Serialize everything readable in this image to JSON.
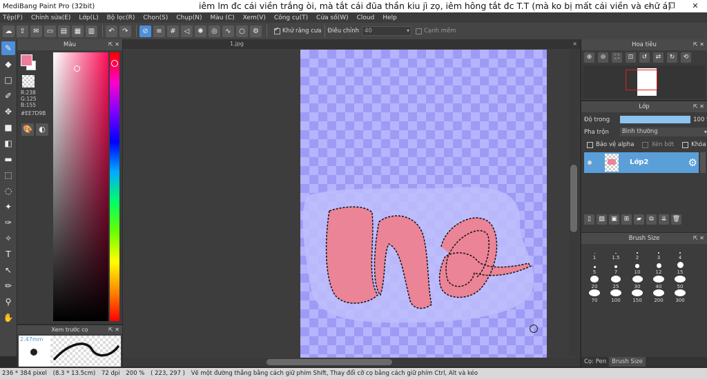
{
  "window": {
    "title": "MediBang Paint Pro (32bit)",
    "overlay_caption": "iêm lm đc cái viền trắng òi, mà tắt cái đũa thần kiu jì zọ, iêm hông tắt đc T.T (mà ko bị mất cái viền và chữ á)",
    "controls": [
      "—",
      "❐",
      "✕"
    ]
  },
  "menu": [
    "Tệp(F)",
    "Chỉnh sửa(E)",
    "Lớp(L)",
    "Bộ lọc(R)",
    "Chọn(S)",
    "Chụp(N)",
    "Màu (C)",
    "Xem(V)",
    "Công cụ(T)",
    "Cửa số(W)",
    "Cloud",
    "Help"
  ],
  "toolbar": {
    "antialias_label": "Khử răng cưa",
    "antialias_checked": true,
    "correction_label": "Điều chỉnh",
    "correction_value": "40",
    "edge_label": "Cạnh mềm",
    "edge_checked": false
  },
  "color_panel": {
    "title": "Màu",
    "foreground": "#EE7D9B",
    "background": "#FFFFFF",
    "r_label": "R:238",
    "g_label": "G:125",
    "b_label": "B:155",
    "hex_label": "#EE7D9B"
  },
  "brush_preview": {
    "title": "Xem trước cọ",
    "size_label": "2.47mm"
  },
  "document": {
    "tab_name": "1.jpg",
    "close": "×",
    "canvas_color": "#aaa8fb",
    "stroke_color": "#ea8496"
  },
  "navigator": {
    "title": "Hoa tiêu"
  },
  "layer_panel": {
    "title": "Lớp",
    "opacity_label": "Độ trong",
    "opacity_value": "100 %",
    "opacity_fraction": 1.0,
    "blend_label": "Pha trộn",
    "blend_value": "Bình thường",
    "protect_alpha_label": "Bảo vệ alpha",
    "clip_label": "Xén bớt",
    "lock_label": "Khóa",
    "layer_name": "Lớp2"
  },
  "brush_size_panel": {
    "title": "Brush Size",
    "sizes": [
      {
        "label": "1",
        "d": 1
      },
      {
        "label": "1.5",
        "d": 1.3
      },
      {
        "label": "2",
        "d": 1.6
      },
      {
        "label": "3",
        "d": 2
      },
      {
        "label": "4",
        "d": 2.5
      },
      {
        "label": "5",
        "d": 3
      },
      {
        "label": "7",
        "d": 4
      },
      {
        "label": "10",
        "d": 5.5
      },
      {
        "label": "12",
        "d": 7
      },
      {
        "label": "15",
        "d": 9
      },
      {
        "label": "20",
        "d": 12
      },
      {
        "label": "25",
        "d": 14
      },
      {
        "label": "30",
        "d": 15
      },
      {
        "label": "40",
        "d": 16
      },
      {
        "label": "50",
        "d": 16
      },
      {
        "label": "70",
        "d": 16
      },
      {
        "label": "100",
        "d": 16
      },
      {
        "label": "150",
        "d": 16
      },
      {
        "label": "200",
        "d": 16
      },
      {
        "label": "300",
        "d": 16
      }
    ]
  },
  "bottom_tabs": [
    "Cọ: Pen",
    "Brush Size"
  ],
  "status": {
    "size": "236 * 384 pixel",
    "physical": "(8.3 * 13.5cm)",
    "dpi": "72 dpi",
    "zoom": "200 %",
    "coords": "( 223, 297 )",
    "hint": "Vẽ một đường thẳng bằng cách giữ phím Shift, Thay đổi cỡ cọ bằng cách giữ phím Ctrl, Alt và kéo"
  }
}
